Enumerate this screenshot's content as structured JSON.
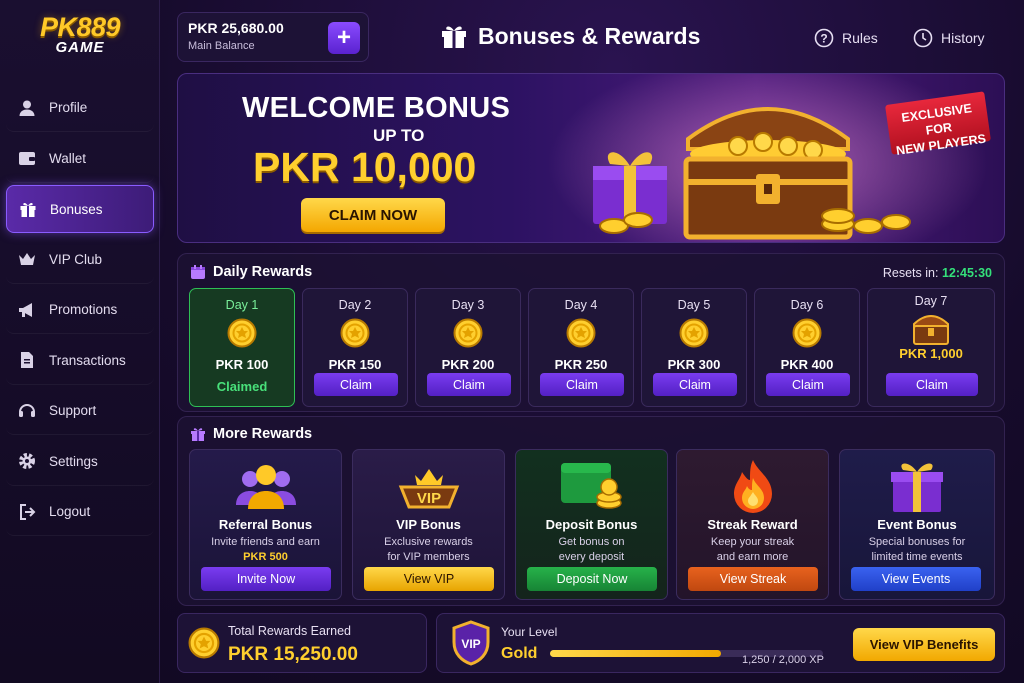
{
  "logo": {
    "line1": "PK889",
    "line2": "GAME"
  },
  "nav": [
    {
      "label": "Profile",
      "icon": "user-icon"
    },
    {
      "label": "Wallet",
      "icon": "wallet-icon"
    },
    {
      "label": "Bonuses",
      "icon": "gift-icon",
      "active": true
    },
    {
      "label": "VIP Club",
      "icon": "crown-icon"
    },
    {
      "label": "Promotions",
      "icon": "megaphone-icon"
    },
    {
      "label": "Transactions",
      "icon": "document-icon"
    },
    {
      "label": "Support",
      "icon": "headset-icon"
    },
    {
      "label": "Settings",
      "icon": "gear-icon"
    },
    {
      "label": "Logout",
      "icon": "logout-icon"
    }
  ],
  "balance": {
    "amount": "PKR 25,680.00",
    "label": "Main Balance",
    "add": "+"
  },
  "header": {
    "title": "Bonuses & Rewards",
    "rules": "Rules",
    "history": "History"
  },
  "banner": {
    "line1": "WELCOME BONUS",
    "line2": "UP TO",
    "amount": "PKR 10,000",
    "cta": "CLAIM NOW",
    "badge_line1": "EXCLUSIVE FOR",
    "badge_line2": "NEW PLAYERS"
  },
  "daily": {
    "title": "Daily Rewards",
    "resets_label": "Resets in:",
    "resets_time": "12:45:30",
    "days": [
      {
        "day": "Day 1",
        "amount": "PKR 100",
        "status": "Claimed"
      },
      {
        "day": "Day 2",
        "amount": "PKR 150",
        "status": "Claim"
      },
      {
        "day": "Day 3",
        "amount": "PKR 200",
        "status": "Claim"
      },
      {
        "day": "Day 4",
        "amount": "PKR 250",
        "status": "Claim"
      },
      {
        "day": "Day 5",
        "amount": "PKR 300",
        "status": "Claim"
      },
      {
        "day": "Day 6",
        "amount": "PKR 400",
        "status": "Claim"
      },
      {
        "day": "Day 7",
        "amount": "PKR 1,000",
        "status": "Claim"
      }
    ]
  },
  "more": {
    "title": "More Rewards",
    "cards": [
      {
        "title": "Referral Bonus",
        "line1": "Invite friends and earn",
        "line2": "PKR 500",
        "button": "Invite Now",
        "icon": "people-icon",
        "color": "#6a2fe0"
      },
      {
        "title": "VIP Bonus",
        "line1": "Exclusive rewards",
        "line2": "for VIP members",
        "button": "View VIP",
        "icon": "vip-crown-icon",
        "color": "#f2b400"
      },
      {
        "title": "Deposit Bonus",
        "line1": "Get bonus on",
        "line2": "every deposit",
        "button": "Deposit Now",
        "icon": "wallet-coins-icon",
        "color": "#1f9a3e"
      },
      {
        "title": "Streak Reward",
        "line1": "Keep your streak",
        "line2": "and earn more",
        "button": "View Streak",
        "icon": "fire-icon",
        "color": "#d9581a"
      },
      {
        "title": "Event Bonus",
        "line1": "Special bonuses for",
        "line2": "limited time events",
        "button": "View Events",
        "icon": "gift-box-icon",
        "color": "#2a50d8"
      }
    ]
  },
  "earned": {
    "label": "Total Rewards Earned",
    "amount": "PKR 15,250.00"
  },
  "level": {
    "label": "Your Level",
    "tier": "Gold",
    "progress_text": "1,250 / 2,000 XP",
    "progress": 0.625,
    "badge": "VIP",
    "cta": "View VIP Benefits"
  }
}
